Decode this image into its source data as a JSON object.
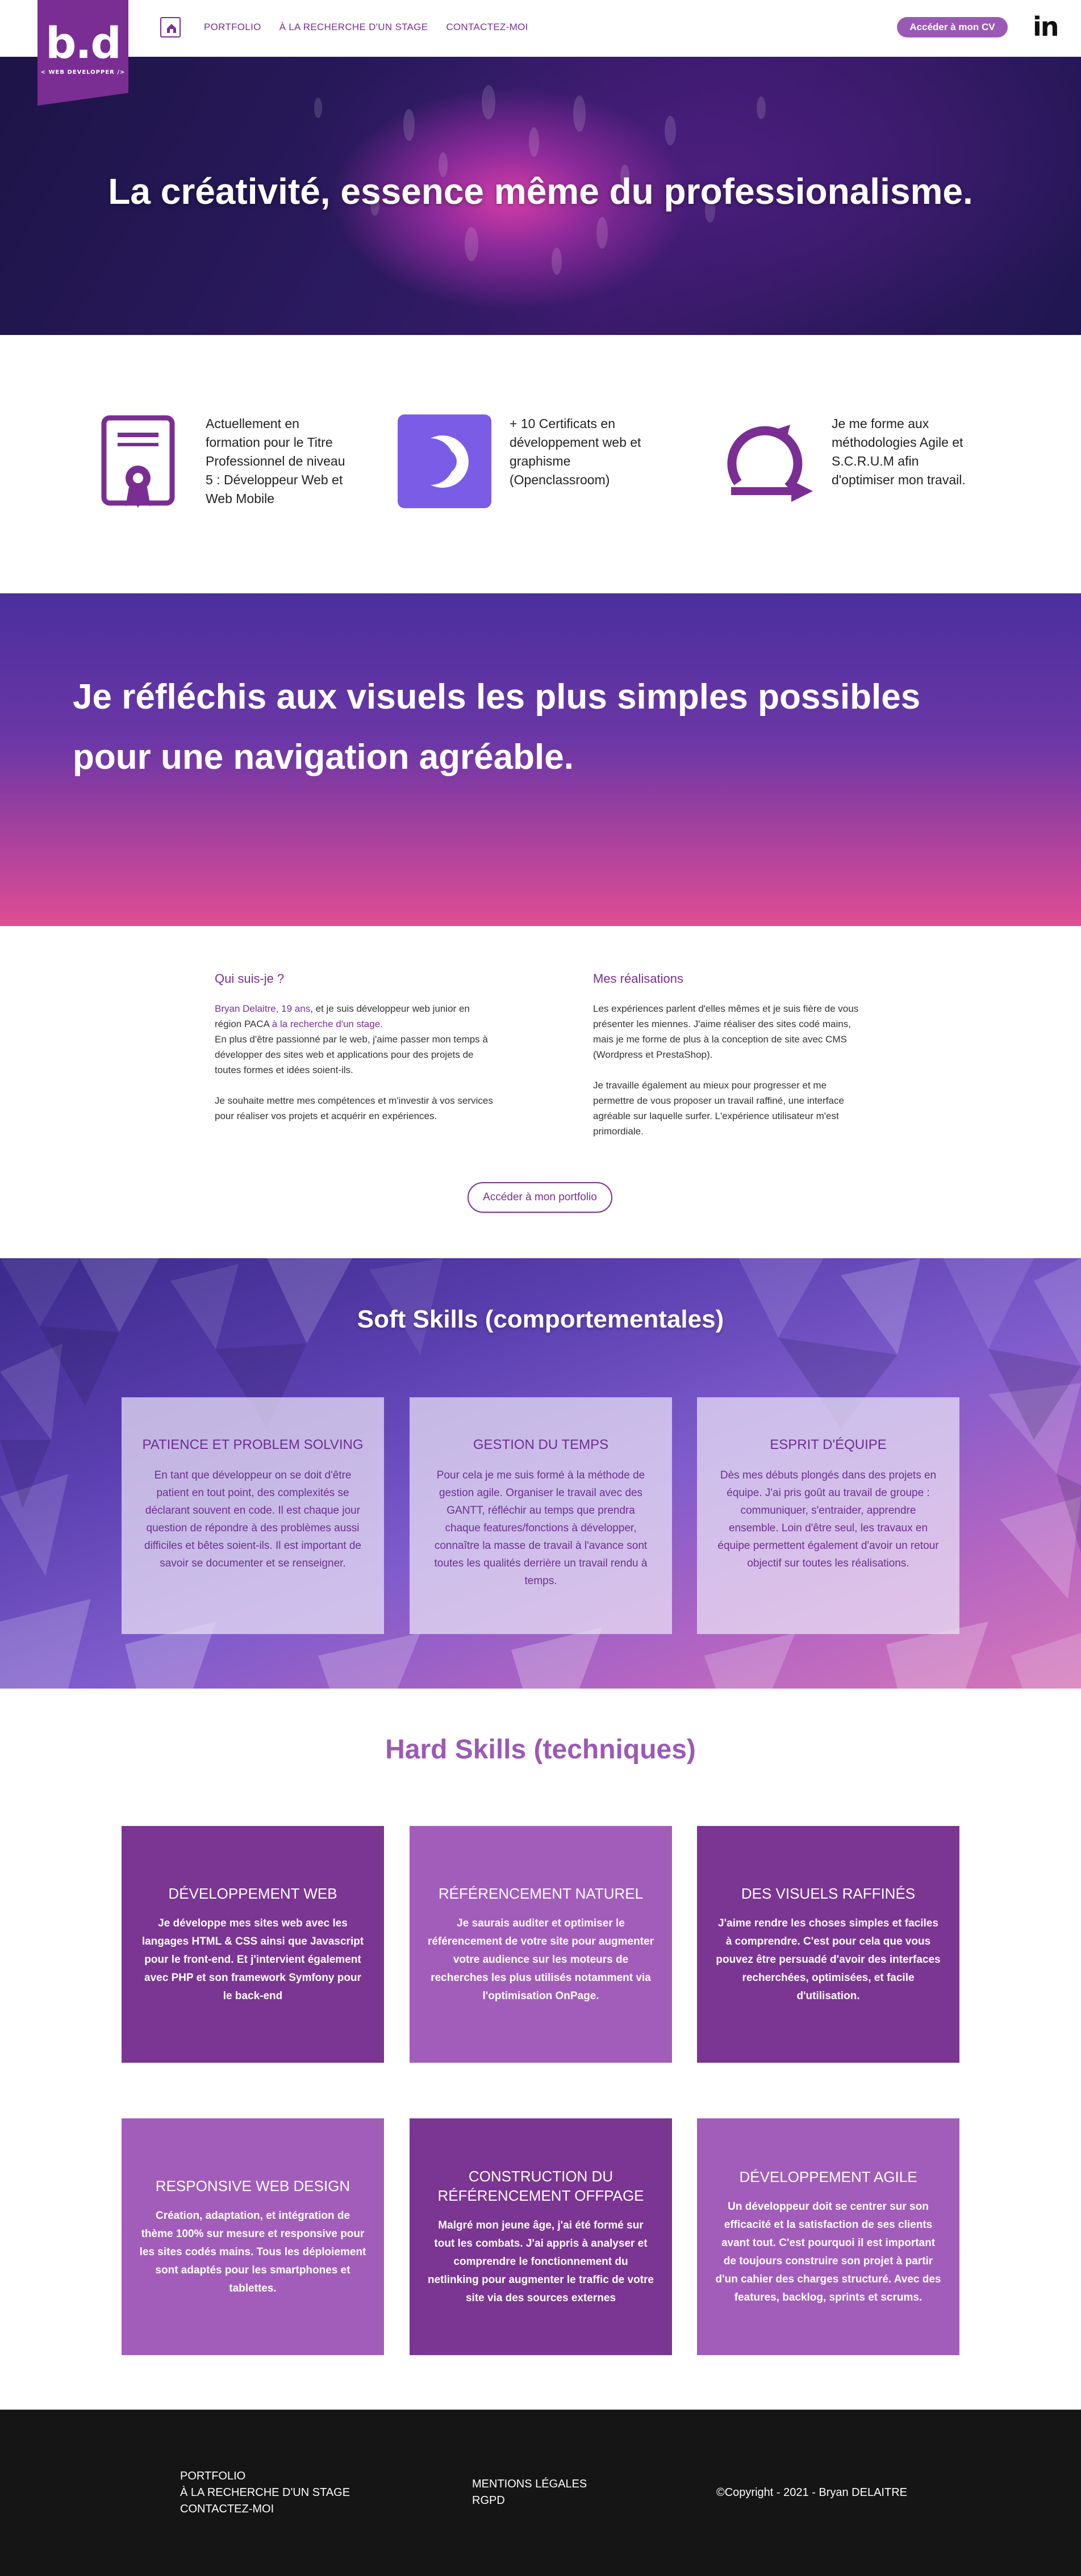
{
  "nav": {
    "logo_text": "b.d",
    "logo_subtext": "< WEB DEVELOPPER />",
    "links": [
      "PORTFOLIO",
      "À LA RECHERCHE D'UN STAGE",
      "CONTACTEZ-MOI"
    ],
    "cv_button": "Accéder à mon CV",
    "social_icon": "linkedin-icon",
    "social_text": "in"
  },
  "hero": {
    "title": "La créativité, essence même du professionalisme."
  },
  "features": [
    {
      "icon": "certificate-icon",
      "text": "Actuellement en formation pour le Titre Professionnel de niveau 5 : Développeur Web et Web Mobile"
    },
    {
      "icon": "openclassrooms-icon",
      "text": "+ 10 Certificats en développement web et graphisme (Openclassroom)"
    },
    {
      "icon": "agile-cycle-icon",
      "text": "Je me forme aux méthodologies Agile et S.C.R.U.M afin d'optimiser mon travail."
    }
  ],
  "band": {
    "title": "Je réfléchis aux visuels les plus simples possibles pour une navigation agréable."
  },
  "about": {
    "who": {
      "title": "Qui suis-je ?",
      "name": "Bryan Delaitre, 19 ans",
      "line1_middle": ", et je suis développeur web junior en région PACA ",
      "stage_link": "à la recherche d'un stage",
      "line1_end": ".",
      "p1": "En plus d'être passionné par le web, j'aime passer mon temps à développer des sites web et applications pour des projets de toutes formes et idées soient-ils.",
      "p2": "Je souhaite mettre mes compétences et m'investir à vos services pour réaliser vos projets et acquérir en expériences."
    },
    "work": {
      "title": "Mes réalisations",
      "p1": "Les expériences parlent d'elles mêmes et je suis fière de vous présenter les miennes. J'aime réaliser des sites codé mains, mais je me forme de plus à la conception de site avec CMS (Wordpress et PrestaShop).",
      "p2": "Je travaille également au mieux pour progresser et me permettre de vous proposer un travail raffiné, une interface agréable sur laquelle surfer. L'expérience utilisateur m'est primordiale."
    },
    "portfolio_button": "Accéder à mon portfolio"
  },
  "soft": {
    "title": "Soft Skills (comportementales)",
    "cards": [
      {
        "title": "PATIENCE ET PROBLEM SOLVING",
        "text": "En tant que développeur on se doit d'être patient en tout point, des complexités se déclarant souvent en code. Il est chaque jour question de répondre à des problèmes aussi difficiles et bêtes soient-ils. Il est important de savoir se documenter et se renseigner."
      },
      {
        "title": "GESTION DU TEMPS",
        "text": "Pour cela je me suis formé à la méthode de gestion agile. Organiser le travail avec des GANTT, réfléchir au temps que prendra chaque features/fonctions à développer, connaître la masse de travail à l'avance sont toutes les qualités derrière un travail rendu à temps."
      },
      {
        "title": "ESPRIT D'ÉQUIPE",
        "text": "Dès mes débuts plongés dans des projets en équipe. J'ai pris goût au travail de groupe : communiquer, s'entraider, apprendre ensemble. Loin d'être seul, les travaux en équipe permettent également d'avoir un retour objectif sur toutes les réalisations."
      }
    ]
  },
  "hard": {
    "title": "Hard Skills (techniques)",
    "cards": [
      {
        "title": "DÉVELOPPEMENT WEB",
        "text": "Je développe mes sites web avec les langages HTML & CSS ainsi que Javascript pour le front-end. Et j'intervient également avec PHP et son framework Symfony pour le back-end"
      },
      {
        "title": "RÉFÉRENCEMENT NATUREL",
        "text": "Je saurais auditer et optimiser le référencement de votre site pour augmenter votre audience sur les moteurs de recherches les plus utilisés notamment via l'optimisation OnPage."
      },
      {
        "title": "DES VISUELS RAFFINÉS",
        "text": "J'aime rendre les choses simples et faciles à comprendre. C'est pour cela que vous pouvez être persuadé d'avoir des interfaces recherchées, optimisées, et facile d'utilisation."
      },
      {
        "title": "RESPONSIVE WEB DESIGN",
        "text": "Création, adaptation, et intégration de thème 100% sur mesure et responsive pour les sites codés mains. Tous les déploiement sont adaptés pour les smartphones et tablettes."
      },
      {
        "title": "CONSTRUCTION DU RÉFÉRENCEMENT OFFPAGE",
        "text": "Malgré mon jeune âge, j'ai été formé sur tout les combats. J'ai appris à analyser et comprendre le fonctionnement du netlinking pour augmenter le traffic de votre site via des sources externes"
      },
      {
        "title": "DÉVELOPPEMENT AGILE",
        "text": "Un développeur doit se centrer sur son efficacité et la satisfaction de ses clients avant tout. C'est pourquoi il est important de toujours construire son projet à partir d'un cahier des charges structuré. Avec des features, backlog, sprints et scrums."
      }
    ]
  },
  "footer": {
    "nav": [
      "PORTFOLIO",
      "À LA RECHERCHE D'UN STAGE",
      "CONTACTEZ-MOI"
    ],
    "legal": [
      "MENTIONS LÉGALES",
      "RGPD"
    ],
    "copyright": "©Copyright - 2021 - Bryan DELAITRE"
  },
  "colors": {
    "brand_purple": "#7a2e93",
    "light_purple": "#a25dbb",
    "accent_violet": "#7b5ce6",
    "footer_bg": "#151515"
  }
}
